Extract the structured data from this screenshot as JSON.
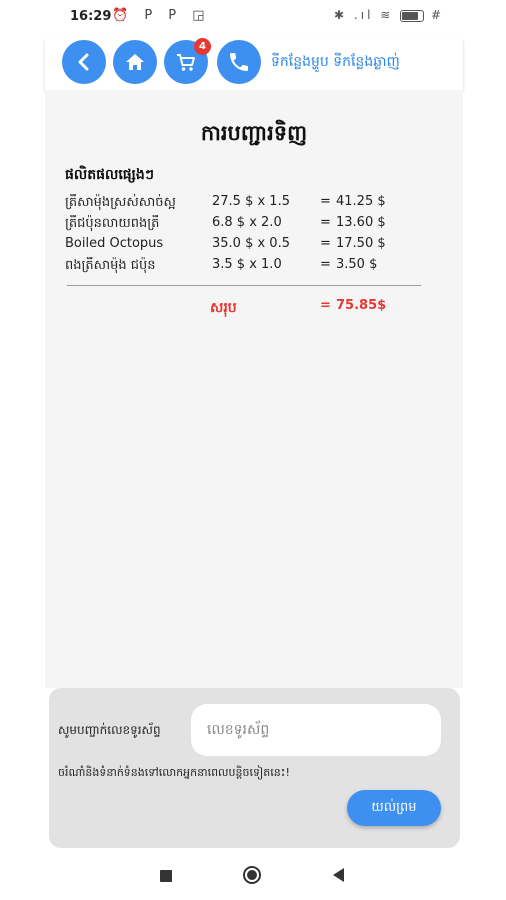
{
  "status_bar": {
    "time": "16:29",
    "left_icons": "⏰ P P ◲",
    "right_icons": "✱ .ıl ≋",
    "extra": "#"
  },
  "appbar": {
    "cart_count": "4",
    "brand_text": "ទីកន្លែងម្ហូប ទីកន្លែងឆ្ងាញ់",
    "icons": [
      "back-icon",
      "home-icon",
      "cart-icon",
      "phone-icon"
    ],
    "accent_color": "#3d8ff0"
  },
  "receipt": {
    "title": "ការបញ្ជារទិញ",
    "section_label": "ផលិតផលផ្សេងៗ",
    "items": [
      {
        "name": "ត្រីសាម៉ុងស្រស់សាច់ស្អ",
        "calc": "27.5 $ x 1.5",
        "eq": "=",
        "total": "41.25 $"
      },
      {
        "name": "ត្រីជប៉ុនលាយពងត្រី",
        "calc": "6.8 $ x 2.0",
        "eq": "=",
        "total": "13.60 $"
      },
      {
        "name": "Boiled Octopus",
        "calc": "35.0 $ x 0.5",
        "eq": "=",
        "total": "17.50 $"
      },
      {
        "name": "ពងត្រីសាម៉ុង ជប៉ុន",
        "calc": "3.5 $ x 1.0",
        "eq": "=",
        "total": "3.50 $"
      }
    ],
    "sum_label": "សរុប",
    "sum_eq": "=",
    "sum_value": "75.85$",
    "sum_color": "#e53935"
  },
  "order_panel": {
    "phone_label": "សូមបញ្ចាក់លេខទូរស័ព្ទ",
    "phone_placeholder": "លេខទូរស័ព្ទ",
    "note": "ចរំណាំនិងទំនាក់ទំនងទៅលោកអ្នកនាពេលបន្តិចទៀតនេះ!",
    "confirm_label": "យល់ព្រម"
  }
}
